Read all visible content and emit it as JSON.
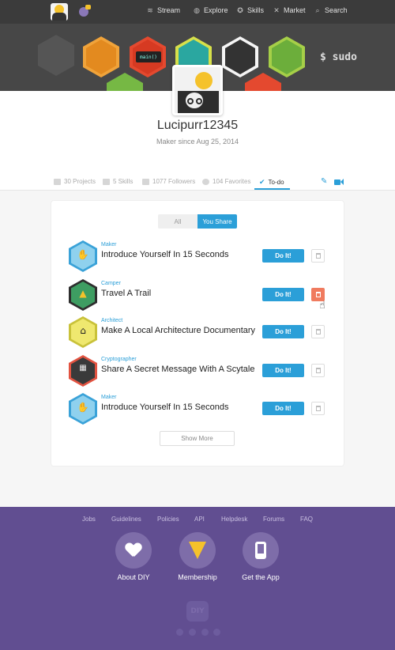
{
  "nav": {
    "links": [
      {
        "label": "Stream",
        "icon": "stream-icon"
      },
      {
        "label": "Explore",
        "icon": "planet-icon"
      },
      {
        "label": "Skills",
        "icon": "skills-icon"
      },
      {
        "label": "Market",
        "icon": "tools-icon"
      },
      {
        "label": "Search",
        "icon": "search-icon"
      }
    ]
  },
  "banner": {
    "terminal_text": "$ sudo",
    "code_badge": "main()"
  },
  "profile": {
    "username": "Lucipurr12345",
    "since": "Maker since Aug 25, 2014"
  },
  "tabs": [
    {
      "label": "30 Projects",
      "icon": "projects-icon"
    },
    {
      "label": "5 Skills",
      "icon": "skills-icon"
    },
    {
      "label": "1077 Followers",
      "icon": "followers-icon"
    },
    {
      "label": "104 Favorites",
      "icon": "heart-icon"
    },
    {
      "label": "To-do",
      "icon": "check-icon",
      "active": true
    }
  ],
  "toggle": {
    "all": "All",
    "share": "You Share"
  },
  "challenges": [
    {
      "skill": "Maker",
      "title": "Introduce Yourself In 15 Seconds",
      "action": "Do It!",
      "badge_color": "#3aa2d8",
      "badge_inner": "#8fd1ee"
    },
    {
      "skill": "Camper",
      "title": "Travel A Trail",
      "action": "Do It!",
      "badge_color": "#2e2e2e",
      "badge_inner": "#3e9d62"
    },
    {
      "skill": "Architect",
      "title": "Make A Local Architecture Documentary",
      "action": "Do It!",
      "badge_color": "#e7e04a",
      "badge_inner": "#f2ec78"
    },
    {
      "skill": "Cryptographer",
      "title": "Share A Secret Message With A Scytale",
      "action": "Do It!",
      "badge_color": "#e25341",
      "badge_inner": "#3a3a3a"
    },
    {
      "skill": "Maker",
      "title": "Introduce Yourself In 15 Seconds",
      "action": "Do It!",
      "badge_color": "#3aa2d8",
      "badge_inner": "#8fd1ee"
    }
  ],
  "show_more": "Show More",
  "footer": {
    "links": [
      "Jobs",
      "Guidelines",
      "Policies",
      "API",
      "Helpdesk",
      "Forums",
      "FAQ"
    ],
    "features": [
      {
        "label": "About DIY",
        "icon": "heart-icon"
      },
      {
        "label": "Membership",
        "icon": "pizza-icon"
      },
      {
        "label": "Get the App",
        "icon": "phone-icon"
      }
    ],
    "logo_text": "DIY"
  },
  "colors": {
    "accent": "#2b9fd8",
    "footer": "#614e91",
    "trash_active": "#f07b5f",
    "nav": "#3b3b3b"
  }
}
